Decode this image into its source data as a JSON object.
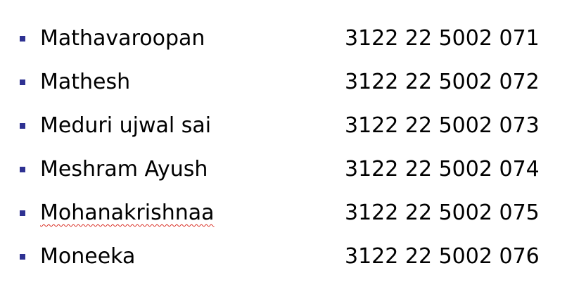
{
  "bullet_color": "#2e3192",
  "spellcheck_underline_color": "#d93025",
  "students": [
    {
      "name": "Mathavaroopan",
      "reg_no": "3122 22 5002 071",
      "misspelled": false
    },
    {
      "name": "Mathesh",
      "reg_no": "3122 22 5002 072",
      "misspelled": false
    },
    {
      "name": "Meduri ujwal sai",
      "reg_no": "3122 22 5002 073",
      "misspelled": false
    },
    {
      "name": "Meshram Ayush",
      "reg_no": "3122 22 5002 074",
      "misspelled": false
    },
    {
      "name": "Mohanakrishnaa",
      "reg_no": "3122 22 5002 075",
      "misspelled": true
    },
    {
      "name": "Moneeka",
      "reg_no": "3122 22 5002 076",
      "misspelled": false
    }
  ]
}
